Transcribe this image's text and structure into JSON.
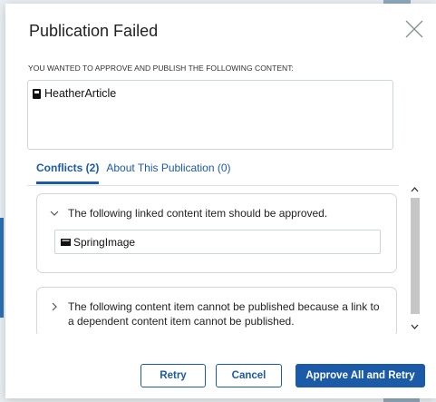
{
  "dialog": {
    "title": "Publication Failed",
    "intro": "YOU WANTED TO APPROVE AND PUBLISH THE FOLLOWING CONTENT:",
    "content_items": [
      {
        "name": "HeatherArticle",
        "icon": "document-icon"
      }
    ]
  },
  "tabs": [
    {
      "label": "Conflicts (2)",
      "active": true
    },
    {
      "label": "About This Publication (0)",
      "active": false
    }
  ],
  "conflicts": [
    {
      "text": "The following linked content item should be approved.",
      "expanded": true,
      "items": [
        {
          "name": "SpringImage",
          "icon": "image-icon"
        }
      ]
    },
    {
      "text": "The following content item cannot be published because a link to a dependent content item cannot be published.",
      "expanded": false
    }
  ],
  "buttons": {
    "retry": "Retry",
    "cancel": "Cancel",
    "approve_all": "Approve All and Retry"
  },
  "colors": {
    "accent": "#1b5aa6",
    "border": "#cfd4d9",
    "scroll_thumb": "#c6c6c6"
  }
}
